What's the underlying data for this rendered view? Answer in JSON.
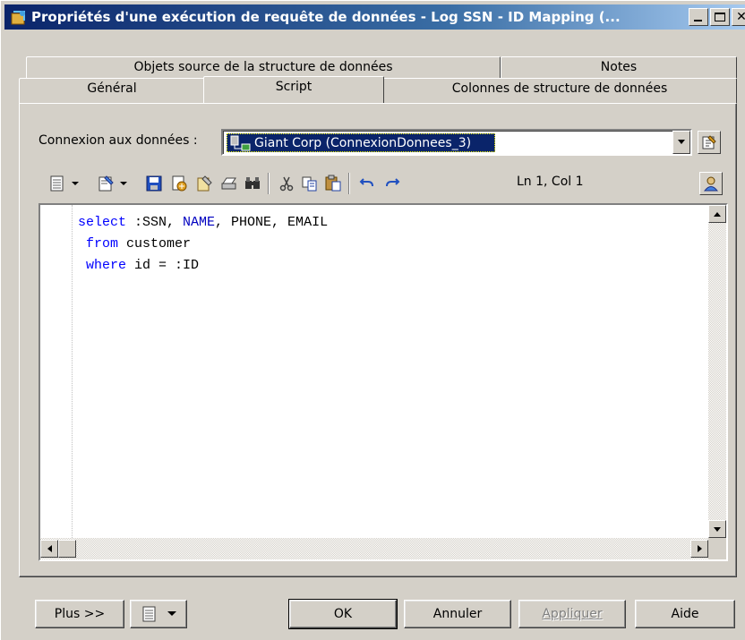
{
  "window": {
    "title": "Propriétés d'une exécution de requête de données - Log SSN - ID Mapping (...",
    "minimize_label": "_",
    "maximize_label": "□",
    "close_label": "✕"
  },
  "tabs": {
    "row_back": [
      {
        "label": "Objets source de la structure de données"
      },
      {
        "label": "Notes"
      }
    ],
    "row_front": [
      {
        "label": "Général"
      },
      {
        "label": "Script",
        "active": true
      },
      {
        "label": "Colonnes de structure de données"
      }
    ]
  },
  "connection": {
    "label": "Connexion aux données :",
    "selected_value": "Giant Corp (ConnexionDonnees_3)"
  },
  "toolbar": {
    "status": "Ln 1, Col 1",
    "icons": [
      "edit-menu-icon",
      "dropdown-arrow-icon",
      "edit-properties-icon",
      "dropdown-arrow-icon",
      "save-icon",
      "import-icon",
      "edit-script-icon",
      "print-icon",
      "find-icon",
      "cut-icon",
      "copy-icon",
      "paste-icon",
      "undo-icon",
      "redo-icon",
      "user-icon"
    ]
  },
  "script": {
    "lines": [
      [
        {
          "t": "select",
          "k": true
        },
        {
          "t": " :SSN, "
        },
        {
          "t": "NAME",
          "k2": true
        },
        {
          "t": ", PHONE, EMAIL"
        }
      ],
      [
        {
          "t": " "
        },
        {
          "t": "from",
          "k": true
        },
        {
          "t": " customer"
        }
      ],
      [
        {
          "t": " "
        },
        {
          "t": "where",
          "k": true
        },
        {
          "t": " id = :ID"
        }
      ]
    ]
  },
  "footer": {
    "more_label": "Plus >>",
    "ok_label": "OK",
    "cancel_label": "Annuler",
    "apply_label": "Appliquer",
    "help_label": "Aide"
  },
  "colors": {
    "titlebar_start": "#0a246a",
    "titlebar_end": "#a6caf0",
    "dialog_bg": "#d4d0c8",
    "keyword": "#0000ff",
    "selection": "#0a246a"
  }
}
